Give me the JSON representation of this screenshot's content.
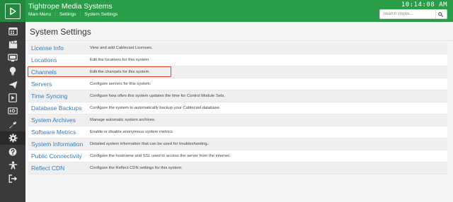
{
  "header": {
    "app_title": "Tightrope Media Systems",
    "breadcrumb": [
      "Main Menu",
      "Settings",
      "System Settings"
    ],
    "breadcrumb_separator": ":",
    "clock": "10:14:08 AM",
    "search_placeholder": "Search shows...",
    "colors": {
      "header_bg": "#2a9d48",
      "sidebar_bg": "#3a3a3d",
      "link": "#3a7ab8",
      "highlight": "#d9452b"
    }
  },
  "sidebar": {
    "items": [
      {
        "icon": "calendar-icon"
      },
      {
        "icon": "clapperboard-icon"
      },
      {
        "icon": "screen-icon"
      },
      {
        "icon": "lightbulb-icon"
      },
      {
        "icon": "send-icon"
      },
      {
        "icon": "film-icon"
      },
      {
        "icon": "io-icon"
      },
      {
        "icon": "wrench-icon"
      },
      {
        "icon": "gear-icon",
        "active": true
      },
      {
        "icon": "help-icon"
      },
      {
        "icon": "person-icon"
      },
      {
        "icon": "logout-icon"
      }
    ]
  },
  "main": {
    "page_title": "System Settings",
    "settings": [
      {
        "label": "License Info",
        "description": "View and add Cablecast Licenses."
      },
      {
        "label": "Locations",
        "description": "Edit the locations for this system."
      },
      {
        "label": "Channels",
        "description": "Edit the channels for this system."
      },
      {
        "label": "Servers",
        "description": "Configure servers for this system."
      },
      {
        "label": "Time Syncing",
        "description": "Configure how often this system updates the time for Control Module Sets."
      },
      {
        "label": "Database Backups",
        "description": "Configure the system to automatically backup your Cablecast database."
      },
      {
        "label": "System Archives",
        "description": "Manage automatic system archives."
      },
      {
        "label": "Software Metrics",
        "description": "Enable or disable anonymous system metrics."
      },
      {
        "label": "System Information",
        "description": "Detailed system information that can be used for troubleshooting."
      },
      {
        "label": "Public Connectivity",
        "description": "Configure the hostname and SSL used to access the server from the internet."
      },
      {
        "label": "Reflect CDN",
        "description": "Configure the Reflect CDN settings for this system."
      }
    ]
  }
}
